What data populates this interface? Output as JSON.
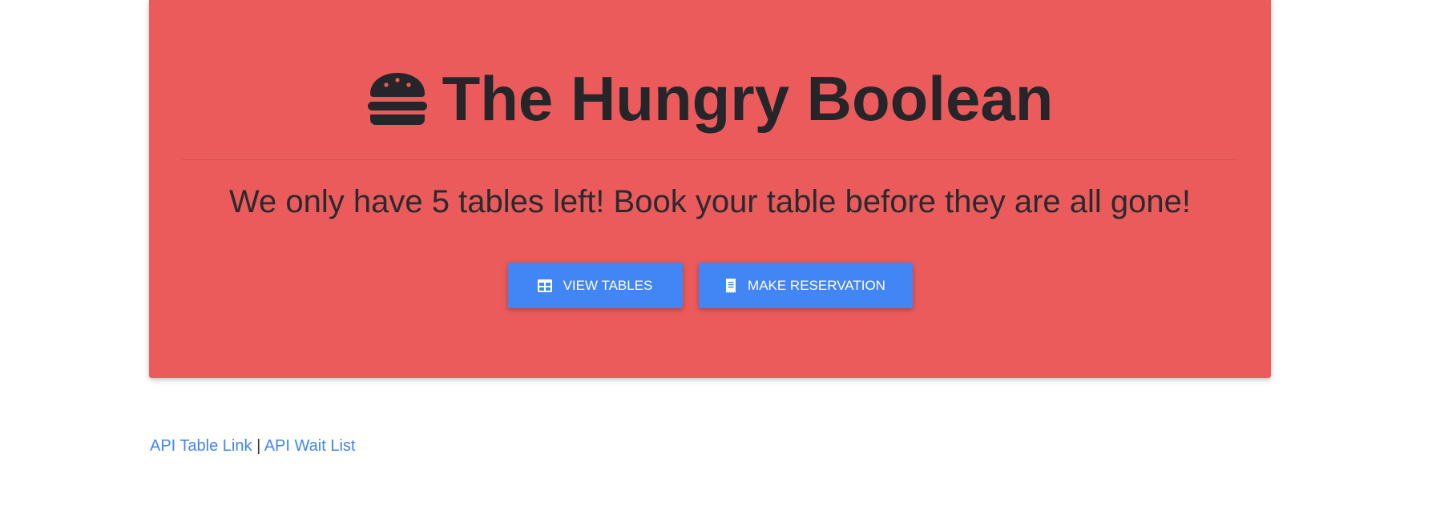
{
  "header": {
    "title": "The Hungry Boolean",
    "icon": "hamburger-icon"
  },
  "main": {
    "tagline": "We only have 5 tables left! Book your table before they are all gone!"
  },
  "buttons": {
    "view_tables": {
      "label": "View Tables",
      "icon": "table-icon"
    },
    "make_reservation": {
      "label": "Make Reservation",
      "icon": "receipt-icon"
    }
  },
  "footer": {
    "api_table_link": "API Table Link",
    "separator": "|",
    "api_wait_list": "API Wait List"
  },
  "colors": {
    "jumbotron_bg": "#ec5b5b",
    "button_bg": "#4285f4",
    "title_text": "#25252a",
    "link": "#4285f4"
  }
}
